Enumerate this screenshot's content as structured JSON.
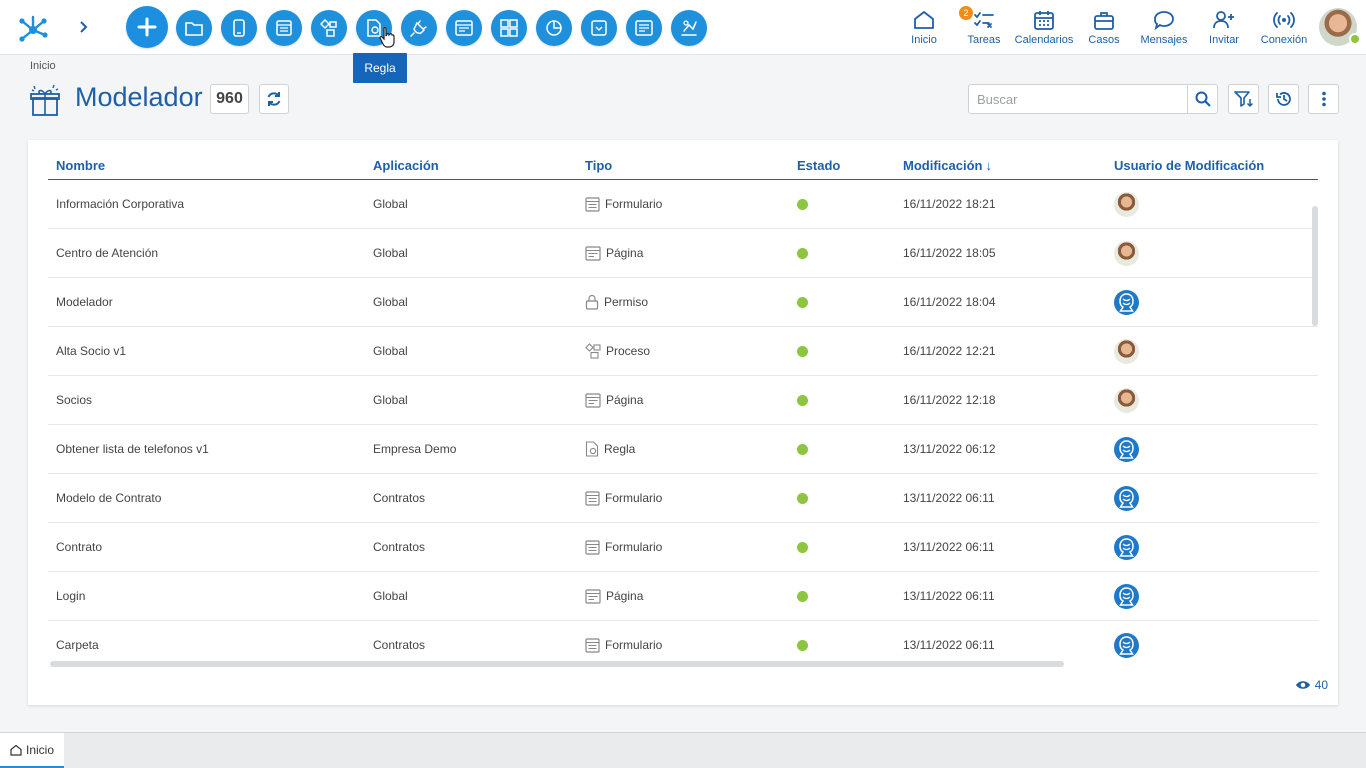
{
  "topbar": {
    "tooltip": "Regla",
    "nav": [
      {
        "icon": "home-icon",
        "label": "Inicio"
      },
      {
        "icon": "tasks-icon",
        "label": "Tareas",
        "badge": "2"
      },
      {
        "icon": "calendar-icon",
        "label": "Calendarios"
      },
      {
        "icon": "briefcase-icon",
        "label": "Casos"
      },
      {
        "icon": "chat-icon",
        "label": "Mensajes"
      },
      {
        "icon": "add-user-icon",
        "label": "Invitar"
      },
      {
        "icon": "signal-icon",
        "label": "Conexión"
      }
    ]
  },
  "header": {
    "breadcrumb": "Inicio",
    "title": "Modelador",
    "count": "960",
    "search_placeholder": "Buscar"
  },
  "table": {
    "columns": [
      "Nombre",
      "Aplicación",
      "Tipo",
      "Estado",
      "Modificación",
      "Usuario de Modificación"
    ],
    "sort_indicator": "↓",
    "rows": [
      {
        "nombre": "Información Corporativa",
        "app": "Global",
        "tipo": "Formulario",
        "tipo_icon": "form-icon",
        "estado": "active",
        "mod": "16/11/2022 18:21",
        "user": "photo"
      },
      {
        "nombre": "Centro de Atención",
        "app": "Global",
        "tipo": "Página",
        "tipo_icon": "page-icon",
        "estado": "active",
        "mod": "16/11/2022 18:05",
        "user": "photo"
      },
      {
        "nombre": "Modelador",
        "app": "Global",
        "tipo": "Permiso",
        "tipo_icon": "lock-icon",
        "estado": "active",
        "mod": "16/11/2022 18:04",
        "user": "default"
      },
      {
        "nombre": "Alta Socio v1",
        "app": "Global",
        "tipo": "Proceso",
        "tipo_icon": "process-icon",
        "estado": "active",
        "mod": "16/11/2022 12:21",
        "user": "photo"
      },
      {
        "nombre": "Socios",
        "app": "Global",
        "tipo": "Página",
        "tipo_icon": "page-icon",
        "estado": "active",
        "mod": "16/11/2022 12:18",
        "user": "photo"
      },
      {
        "nombre": "Obtener lista de telefonos v1",
        "app": "Empresa Demo",
        "tipo": "Regla",
        "tipo_icon": "rule-icon",
        "estado": "active",
        "mod": "13/11/2022 06:12",
        "user": "default"
      },
      {
        "nombre": "Modelo de Contrato",
        "app": "Contratos",
        "tipo": "Formulario",
        "tipo_icon": "form-icon",
        "estado": "active",
        "mod": "13/11/2022 06:11",
        "user": "default"
      },
      {
        "nombre": "Contrato",
        "app": "Contratos",
        "tipo": "Formulario",
        "tipo_icon": "form-icon",
        "estado": "active",
        "mod": "13/11/2022 06:11",
        "user": "default"
      },
      {
        "nombre": "Login",
        "app": "Global",
        "tipo": "Página",
        "tipo_icon": "page-icon",
        "estado": "active",
        "mod": "13/11/2022 06:11",
        "user": "default"
      },
      {
        "nombre": "Carpeta",
        "app": "Contratos",
        "tipo": "Formulario",
        "tipo_icon": "form-icon",
        "estado": "active",
        "mod": "13/11/2022 06:11",
        "user": "default"
      }
    ],
    "views": "40"
  },
  "bottom_tab": "Inicio",
  "colors": {
    "primary": "#1e5fa6",
    "accent": "#1c8fe0",
    "status_active": "#8cc63f",
    "badge": "#f08c1a"
  }
}
